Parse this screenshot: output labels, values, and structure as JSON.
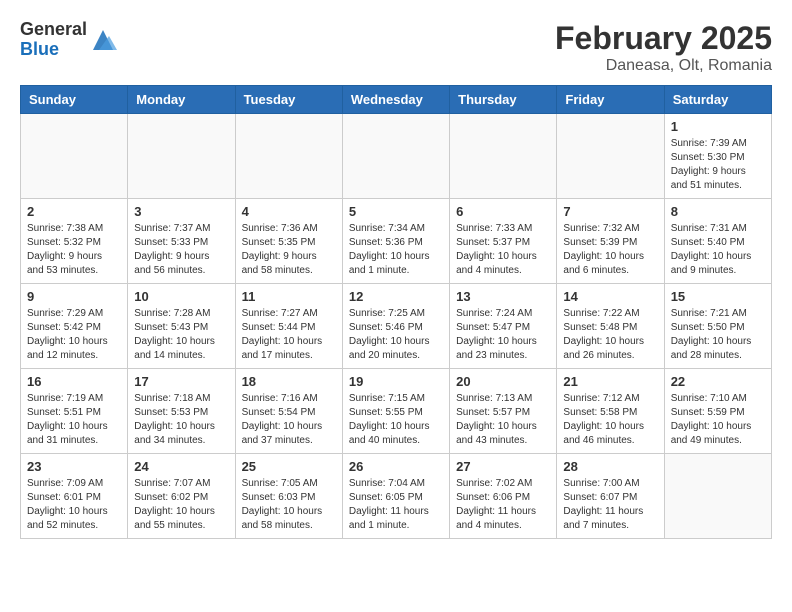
{
  "header": {
    "logo_general": "General",
    "logo_blue": "Blue",
    "month_title": "February 2025",
    "location": "Daneasa, Olt, Romania"
  },
  "weekdays": [
    "Sunday",
    "Monday",
    "Tuesday",
    "Wednesday",
    "Thursday",
    "Friday",
    "Saturday"
  ],
  "weeks": [
    [
      {
        "day": "",
        "info": ""
      },
      {
        "day": "",
        "info": ""
      },
      {
        "day": "",
        "info": ""
      },
      {
        "day": "",
        "info": ""
      },
      {
        "day": "",
        "info": ""
      },
      {
        "day": "",
        "info": ""
      },
      {
        "day": "1",
        "info": "Sunrise: 7:39 AM\nSunset: 5:30 PM\nDaylight: 9 hours and 51 minutes."
      }
    ],
    [
      {
        "day": "2",
        "info": "Sunrise: 7:38 AM\nSunset: 5:32 PM\nDaylight: 9 hours and 53 minutes."
      },
      {
        "day": "3",
        "info": "Sunrise: 7:37 AM\nSunset: 5:33 PM\nDaylight: 9 hours and 56 minutes."
      },
      {
        "day": "4",
        "info": "Sunrise: 7:36 AM\nSunset: 5:35 PM\nDaylight: 9 hours and 58 minutes."
      },
      {
        "day": "5",
        "info": "Sunrise: 7:34 AM\nSunset: 5:36 PM\nDaylight: 10 hours and 1 minute."
      },
      {
        "day": "6",
        "info": "Sunrise: 7:33 AM\nSunset: 5:37 PM\nDaylight: 10 hours and 4 minutes."
      },
      {
        "day": "7",
        "info": "Sunrise: 7:32 AM\nSunset: 5:39 PM\nDaylight: 10 hours and 6 minutes."
      },
      {
        "day": "8",
        "info": "Sunrise: 7:31 AM\nSunset: 5:40 PM\nDaylight: 10 hours and 9 minutes."
      }
    ],
    [
      {
        "day": "9",
        "info": "Sunrise: 7:29 AM\nSunset: 5:42 PM\nDaylight: 10 hours and 12 minutes."
      },
      {
        "day": "10",
        "info": "Sunrise: 7:28 AM\nSunset: 5:43 PM\nDaylight: 10 hours and 14 minutes."
      },
      {
        "day": "11",
        "info": "Sunrise: 7:27 AM\nSunset: 5:44 PM\nDaylight: 10 hours and 17 minutes."
      },
      {
        "day": "12",
        "info": "Sunrise: 7:25 AM\nSunset: 5:46 PM\nDaylight: 10 hours and 20 minutes."
      },
      {
        "day": "13",
        "info": "Sunrise: 7:24 AM\nSunset: 5:47 PM\nDaylight: 10 hours and 23 minutes."
      },
      {
        "day": "14",
        "info": "Sunrise: 7:22 AM\nSunset: 5:48 PM\nDaylight: 10 hours and 26 minutes."
      },
      {
        "day": "15",
        "info": "Sunrise: 7:21 AM\nSunset: 5:50 PM\nDaylight: 10 hours and 28 minutes."
      }
    ],
    [
      {
        "day": "16",
        "info": "Sunrise: 7:19 AM\nSunset: 5:51 PM\nDaylight: 10 hours and 31 minutes."
      },
      {
        "day": "17",
        "info": "Sunrise: 7:18 AM\nSunset: 5:53 PM\nDaylight: 10 hours and 34 minutes."
      },
      {
        "day": "18",
        "info": "Sunrise: 7:16 AM\nSunset: 5:54 PM\nDaylight: 10 hours and 37 minutes."
      },
      {
        "day": "19",
        "info": "Sunrise: 7:15 AM\nSunset: 5:55 PM\nDaylight: 10 hours and 40 minutes."
      },
      {
        "day": "20",
        "info": "Sunrise: 7:13 AM\nSunset: 5:57 PM\nDaylight: 10 hours and 43 minutes."
      },
      {
        "day": "21",
        "info": "Sunrise: 7:12 AM\nSunset: 5:58 PM\nDaylight: 10 hours and 46 minutes."
      },
      {
        "day": "22",
        "info": "Sunrise: 7:10 AM\nSunset: 5:59 PM\nDaylight: 10 hours and 49 minutes."
      }
    ],
    [
      {
        "day": "23",
        "info": "Sunrise: 7:09 AM\nSunset: 6:01 PM\nDaylight: 10 hours and 52 minutes."
      },
      {
        "day": "24",
        "info": "Sunrise: 7:07 AM\nSunset: 6:02 PM\nDaylight: 10 hours and 55 minutes."
      },
      {
        "day": "25",
        "info": "Sunrise: 7:05 AM\nSunset: 6:03 PM\nDaylight: 10 hours and 58 minutes."
      },
      {
        "day": "26",
        "info": "Sunrise: 7:04 AM\nSunset: 6:05 PM\nDaylight: 11 hours and 1 minute."
      },
      {
        "day": "27",
        "info": "Sunrise: 7:02 AM\nSunset: 6:06 PM\nDaylight: 11 hours and 4 minutes."
      },
      {
        "day": "28",
        "info": "Sunrise: 7:00 AM\nSunset: 6:07 PM\nDaylight: 11 hours and 7 minutes."
      },
      {
        "day": "",
        "info": ""
      }
    ]
  ]
}
